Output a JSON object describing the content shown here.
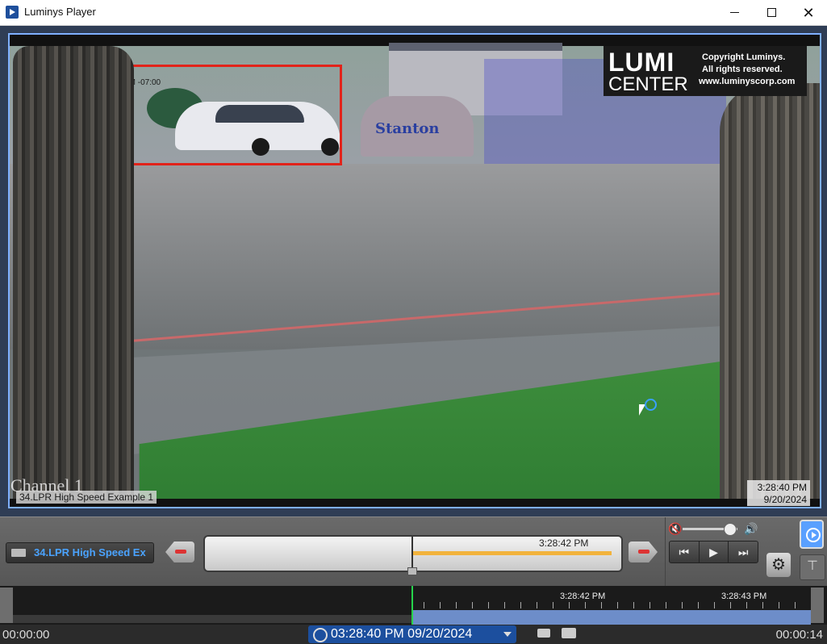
{
  "window": {
    "title": "Luminys Player"
  },
  "video": {
    "overlay_text": "2/20/2024 03:28:40 PM -07:00",
    "sign_text": "Stanton",
    "logo": {
      "line1": "LUMI",
      "line2": "CENTER",
      "copyright1": "Copyright Luminys.",
      "copyright2": "All rights reserved.",
      "url": "www.luminyscorp.com"
    },
    "channel_label": "Channel 1",
    "channel_name": "34.LPR High Speed Example 1",
    "timestamp": {
      "time": "3:28:40 PM",
      "date": "9/20/2024"
    }
  },
  "controls": {
    "clip_selector": "34.LPR High Speed Ex",
    "timeline_label": "3:28:42 PM",
    "timeline_progress": 0.5,
    "volume_level": 0.85,
    "transport": {
      "prev": "⏮",
      "play": "▶",
      "next": "⏭"
    }
  },
  "bottom_timeline": {
    "ticks": [
      "3:28:42 PM",
      "3:28:43 PM"
    ]
  },
  "status": {
    "start": "00:00:00",
    "current_datetime": "03:28:40 PM 09/20/2024",
    "end": "00:00:14"
  },
  "icons": [
    "app-icon",
    "minimize-icon",
    "maximize-icon",
    "close-icon",
    "film-icon",
    "prev-clip-icon",
    "next-clip-icon",
    "mute-icon",
    "volume-icon",
    "gear-icon",
    "play-mode-icon",
    "pin-icon",
    "clock-icon",
    "camera-icon",
    "print-icon",
    "dropdown-caret-icon"
  ],
  "colors": {
    "accent": "#4aa3ff",
    "roi": "#e2231a",
    "playhead": "#26d44b",
    "timeline_bar": "#f2b33d"
  }
}
